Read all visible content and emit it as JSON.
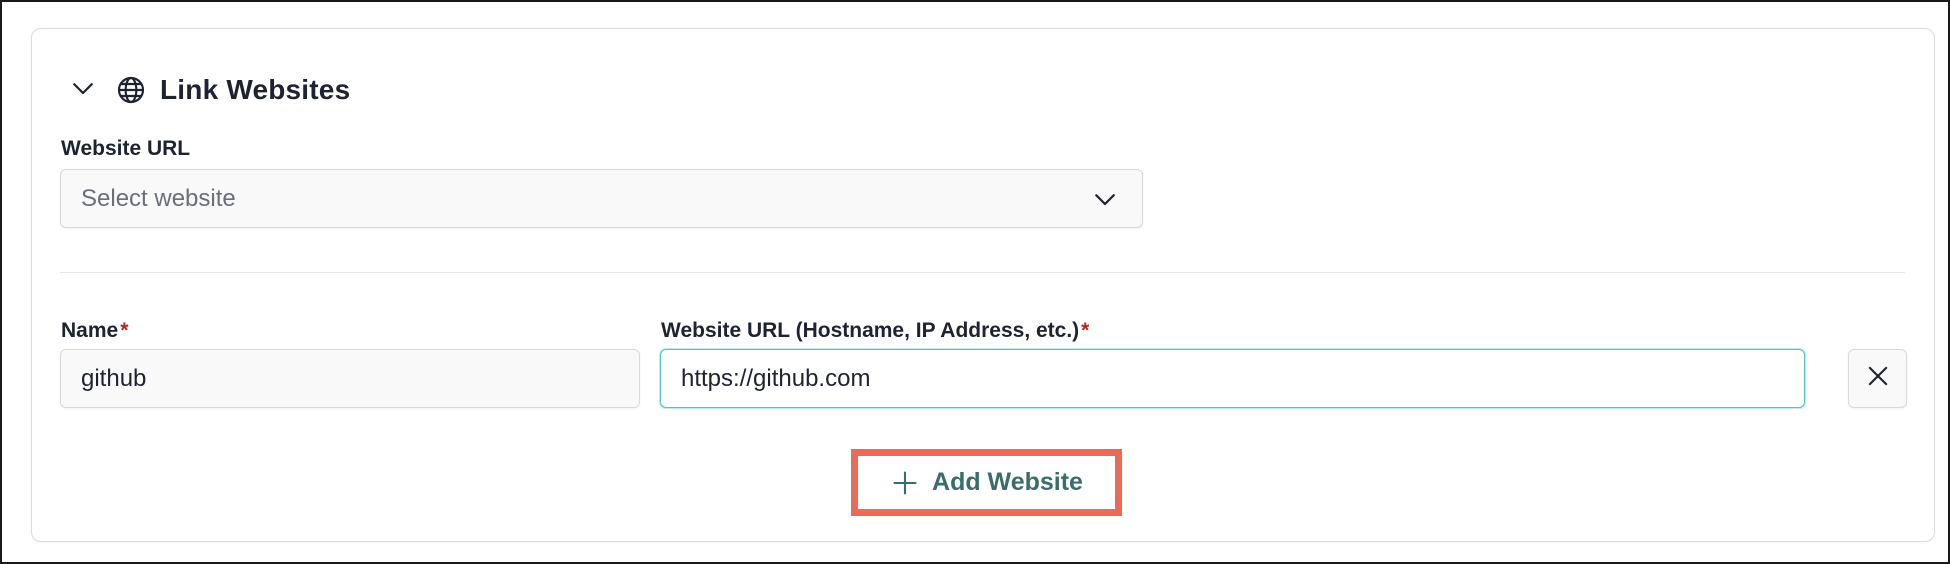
{
  "section": {
    "title": "Link Websites",
    "icons": {
      "toggle": "chevron-down-icon",
      "section": "globe-icon"
    }
  },
  "website_select": {
    "label": "Website URL",
    "placeholder": "Select website",
    "icon": "chevron-down-icon"
  },
  "entry": {
    "name_label": "Name",
    "name_value": "github",
    "url_label": "Website URL (Hostname, IP Address, etc.)",
    "url_value": "https://github.com",
    "required_mark": "*",
    "remove_icon": "close-icon"
  },
  "add_button": {
    "label": "Add Website",
    "icon": "plus-icon"
  },
  "colors": {
    "accent_teal": "#3a6d6a",
    "focus_border": "#4fc7c4",
    "required": "#b3261e",
    "highlight": "#ec6b58"
  }
}
